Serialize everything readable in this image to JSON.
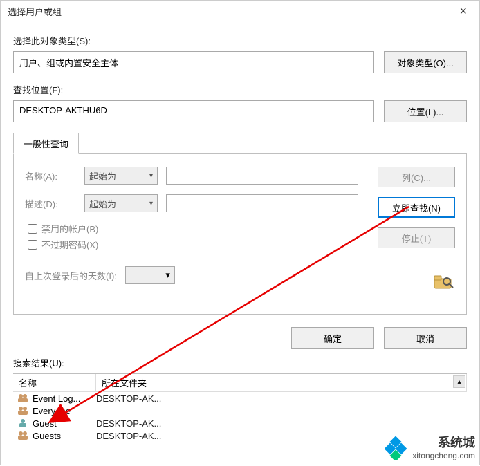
{
  "dialog": {
    "title": "选择用户或组",
    "close": "×"
  },
  "object_type": {
    "label": "选择此对象类型(S):",
    "value": "用户、组或内置安全主体",
    "button": "对象类型(O)..."
  },
  "location": {
    "label": "查找位置(F):",
    "value": "DESKTOP-AKTHU6D",
    "button": "位置(L)..."
  },
  "tab": {
    "label": "一般性查询"
  },
  "query": {
    "name_label": "名称(A):",
    "desc_label": "描述(D):",
    "combo_value": "起始为",
    "disabled_label": "禁用的帐户(B)",
    "nopwd_label": "不过期密码(X)",
    "days_label": "自上次登录后的天数(I):"
  },
  "side_buttons": {
    "columns": "列(C)...",
    "find_now": "立即查找(N)",
    "stop": "停止(T)"
  },
  "dialog_buttons": {
    "ok": "确定",
    "cancel": "取消"
  },
  "results": {
    "label": "搜索结果(U):",
    "col_name": "名称",
    "col_folder": "所在文件夹",
    "rows": [
      {
        "name": "Event Log...",
        "loc": "DESKTOP-AK..."
      },
      {
        "name": "Everyone",
        "loc": ""
      },
      {
        "name": "Guest",
        "loc": "DESKTOP-AK..."
      },
      {
        "name": "Guests",
        "loc": "DESKTOP-AK..."
      }
    ]
  },
  "watermark": {
    "brand": "系统城",
    "url": "xitongcheng.com"
  }
}
